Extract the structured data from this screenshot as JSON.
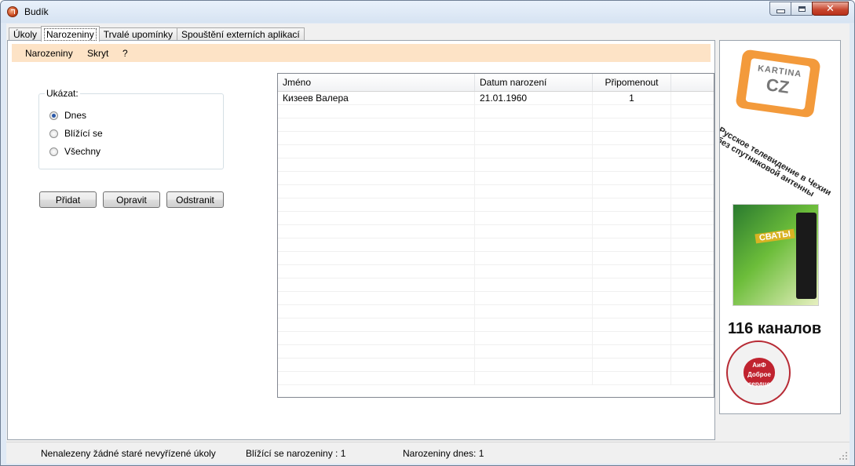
{
  "window": {
    "title": "Budík"
  },
  "tabs": [
    {
      "label": "Úkoly"
    },
    {
      "label": "Narozeniny"
    },
    {
      "label": "Trvalé upomínky"
    },
    {
      "label": "Spouštění externích aplikací"
    }
  ],
  "menu": [
    {
      "label": "Narozeniny"
    },
    {
      "label": "Skryt"
    },
    {
      "label": "?"
    }
  ],
  "show_group": {
    "legend": "Ukázat:",
    "options": [
      {
        "label": "Dnes",
        "checked": true
      },
      {
        "label": "Blížící se",
        "checked": false
      },
      {
        "label": "Všechny",
        "checked": false
      }
    ]
  },
  "buttons": {
    "add": "Přidat",
    "edit": "Opravit",
    "remove": "Odstranit"
  },
  "table": {
    "columns": [
      "Jméno",
      "Datum narození",
      "Připomenout"
    ],
    "rows": [
      [
        "Кизеев Валера",
        "21.01.1960",
        "1"
      ]
    ]
  },
  "ad": {
    "logo_line1": "KARTINA",
    "logo_line2": "CZ",
    "slogan_line1": "Русское телевидение в Чехии",
    "slogan_line2": "без спутниковой антенны",
    "dvd_title": "СВАТЫ",
    "channels": "116 каналов",
    "badge": "АиФ Доброе сердце"
  },
  "status": {
    "old_tasks": "Nenalezeny žádné staré nevyřízené úkoly",
    "upcoming": "Blížící se narozeniny : 1",
    "today": "Narozeniny dnes: 1"
  }
}
